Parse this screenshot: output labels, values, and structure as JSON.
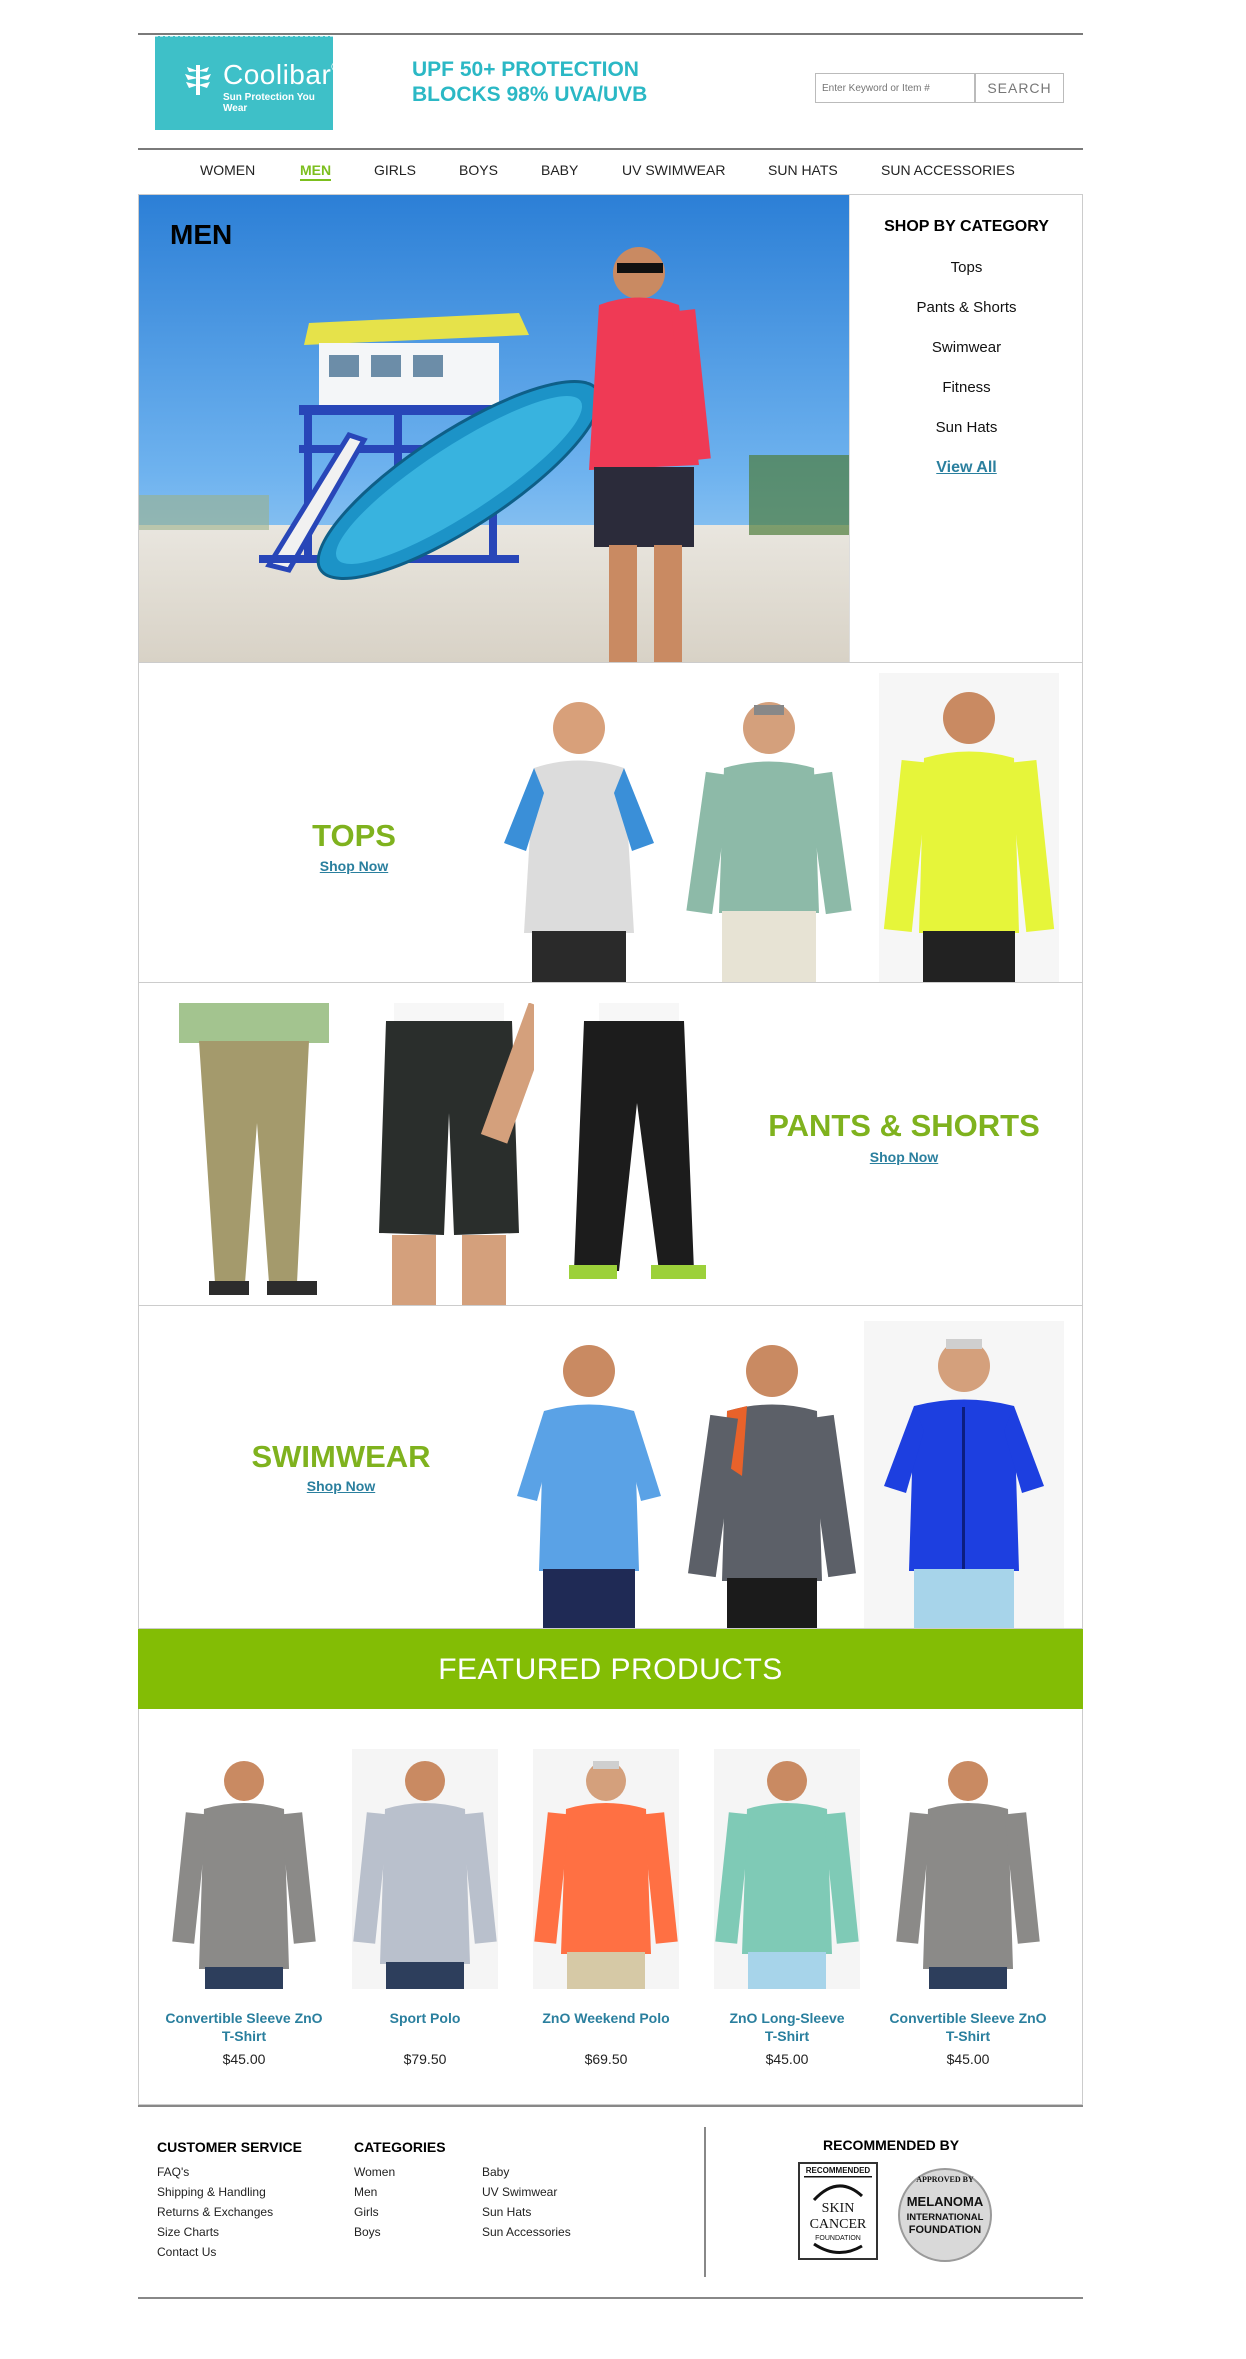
{
  "header": {
    "logo_name": "Coolibar",
    "logo_reg": "®",
    "logo_tagline": "Sun Protection You Wear",
    "promo_line1": "UPF 50+ PROTECTION",
    "promo_line2": "BLOCKS 98% UVA/UVB",
    "search_placeholder": "Enter Keyword or Item #",
    "search_button": "SEARCH"
  },
  "nav": {
    "items": [
      "WOMEN",
      "MEN",
      "GIRLS",
      "BOYS",
      "BABY",
      "UV SWIMWEAR",
      "SUN HATS",
      "SUN ACCESSORIES"
    ],
    "active": "MEN"
  },
  "hero": {
    "title": "MEN",
    "category_heading": "SHOP BY CATEGORY",
    "categories": [
      "Tops",
      "Pants & Shorts",
      "Swimwear",
      "Fitness",
      "Sun Hats"
    ],
    "view_all": "View All"
  },
  "sections": {
    "tops": {
      "title": "TOPS",
      "cta": "Shop Now"
    },
    "pants": {
      "title": "PANTS & SHORTS",
      "cta": "Shop Now"
    },
    "swimwear": {
      "title": "SWIMWEAR",
      "cta": "Shop Now"
    }
  },
  "featured": {
    "title": "FEATURED PRODUCTS",
    "products": [
      {
        "name_line1": "Convertible Sleeve ZnO",
        "name_line2": "T-Shirt",
        "price": "$45.00"
      },
      {
        "name_line1": "Sport Polo",
        "name_line2": "",
        "price": "$79.50"
      },
      {
        "name_line1": "ZnO Weekend Polo",
        "name_line2": "",
        "price": "$69.50"
      },
      {
        "name_line1": "ZnO Long-Sleeve",
        "name_line2": "T-Shirt",
        "price": "$45.00"
      },
      {
        "name_line1": "Convertible Sleeve ZnO",
        "name_line2": "T-Shirt",
        "price": "$45.00"
      }
    ]
  },
  "footer": {
    "customer_service": {
      "heading": "CUSTOMER SERVICE",
      "links": [
        "FAQ's",
        "Shipping & Handling",
        "Returns & Exchanges",
        "Size Charts",
        "Contact Us"
      ]
    },
    "categories": {
      "heading": "CATEGORIES",
      "col1": [
        "Women",
        "Men",
        "Girls",
        "Boys"
      ],
      "col2": [
        "Baby",
        "UV Swimwear",
        "Sun Hats",
        "Sun Accessories"
      ]
    },
    "recommended": {
      "heading": "RECOMMENDED BY",
      "badge1_top": "RECOMMENDED",
      "badge1_main1": "SKIN",
      "badge1_main2": "CANCER",
      "badge1_sub": "FOUNDATION",
      "badge2_top": "APPROVED BY",
      "badge2_line1": "MELANOMA",
      "badge2_line2": "INTERNATIONAL",
      "badge2_line3": "FOUNDATION"
    }
  },
  "colors": {
    "brand_teal": "#3ec0c8",
    "promo_teal": "#2bb8c5",
    "accent_green": "#83bd05",
    "title_green": "#7fb21e",
    "link_blue": "#2a7f9e"
  }
}
